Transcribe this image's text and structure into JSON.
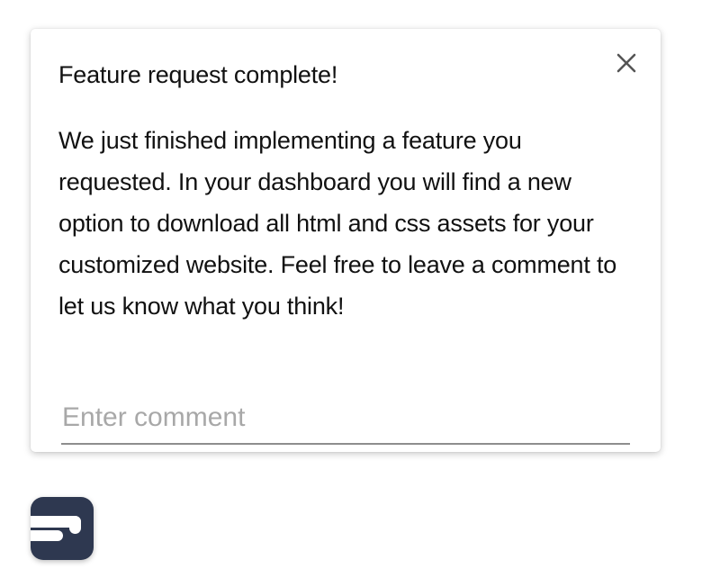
{
  "notification": {
    "title": "Feature request complete!",
    "message": "We just finished implementing a feature you requested. In your dashboard you will find a new option to download all html and css assets for your customized website. Feel free to leave a comment to let us know what you think!",
    "comment_placeholder": "Enter comment",
    "comment_value": "",
    "close_icon": "close-icon"
  },
  "launcher": {
    "icon": "chat-launcher-icon",
    "color": "#2e3850"
  }
}
